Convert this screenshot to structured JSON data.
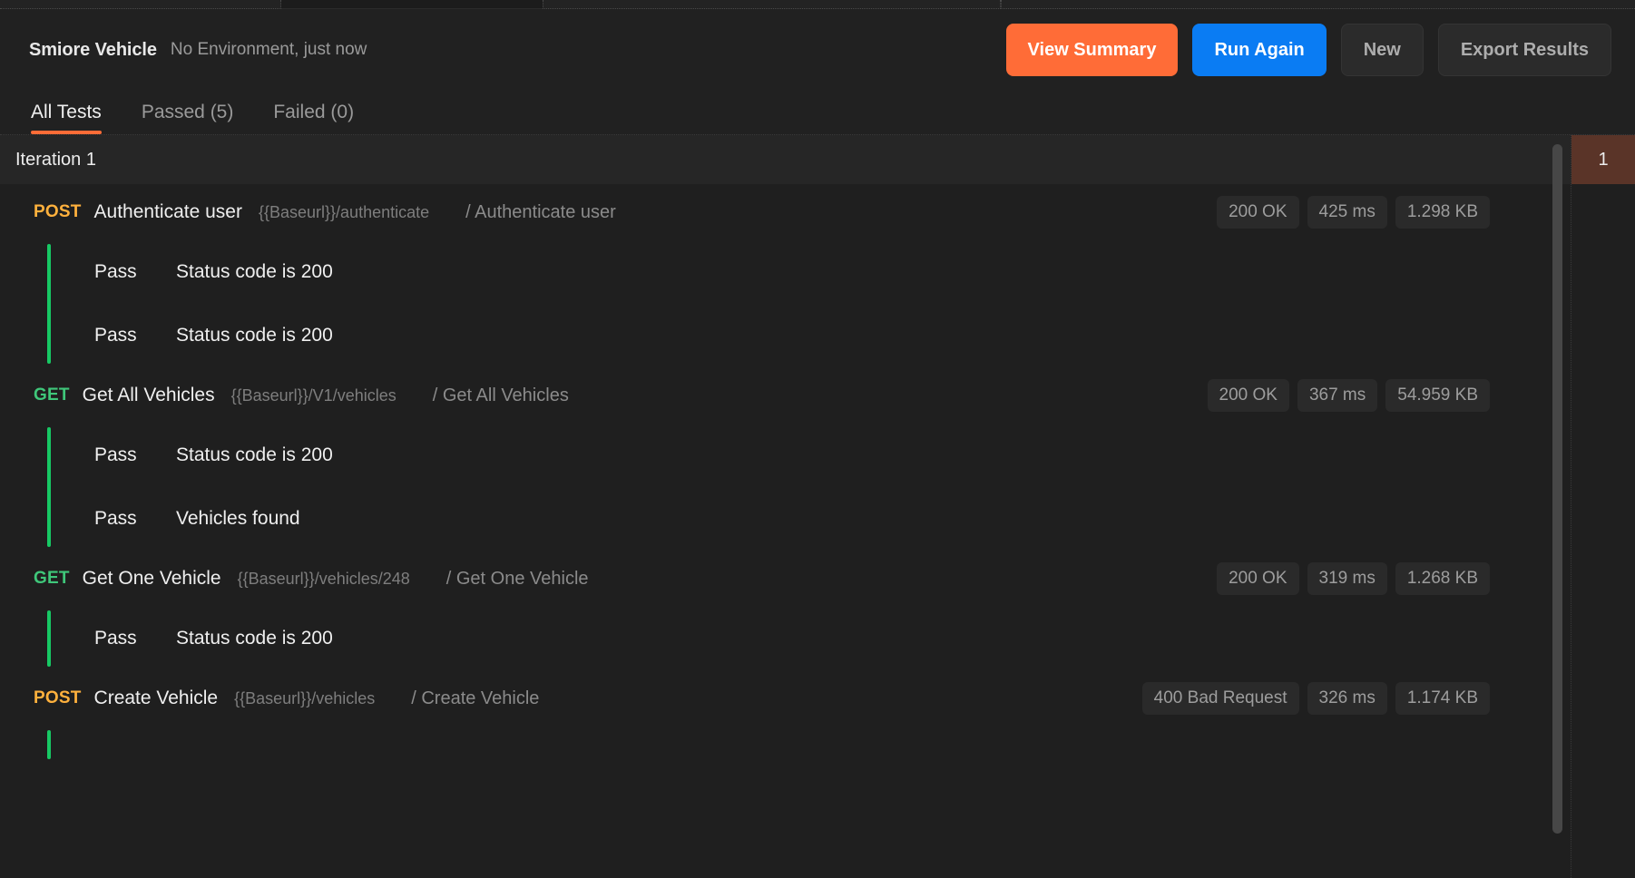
{
  "header": {
    "run_title": "Smiore Vehicle",
    "run_meta": "No Environment, just now",
    "actions": {
      "view_summary": "View Summary",
      "run_again": "Run Again",
      "new": "New",
      "export_results": "Export Results"
    }
  },
  "tabs": [
    {
      "label": "All Tests",
      "active": true
    },
    {
      "label": "Passed (5)",
      "active": false
    },
    {
      "label": "Failed (0)",
      "active": false
    }
  ],
  "iteration": {
    "label": "Iteration 1"
  },
  "requests": [
    {
      "method": "POST",
      "name": "Authenticate user",
      "url": "{{Baseurl}}/authenticate",
      "path": "/ Authenticate user",
      "status": "200 OK",
      "time": "425 ms",
      "size": "1.298 KB",
      "assertions": [
        {
          "result": "Pass",
          "text": "Status code is 200"
        },
        {
          "result": "Pass",
          "text": "Status code is 200"
        }
      ]
    },
    {
      "method": "GET",
      "name": "Get All Vehicles",
      "url": "{{Baseurl}}/V1/vehicles",
      "path": "/ Get All Vehicles",
      "status": "200 OK",
      "time": "367 ms",
      "size": "54.959 KB",
      "assertions": [
        {
          "result": "Pass",
          "text": "Status code is 200"
        },
        {
          "result": "Pass",
          "text": "Vehicles found"
        }
      ]
    },
    {
      "method": "GET",
      "name": "Get One Vehicle",
      "url": "{{Baseurl}}/vehicles/248",
      "path": "/ Get One Vehicle",
      "status": "200 OK",
      "time": "319 ms",
      "size": "1.268 KB",
      "assertions": [
        {
          "result": "Pass",
          "text": "Status code is 200"
        }
      ]
    },
    {
      "method": "POST",
      "name": "Create Vehicle",
      "url": "{{Baseurl}}/vehicles",
      "path": "/ Create Vehicle",
      "status": "400 Bad Request",
      "time": "326 ms",
      "size": "1.174 KB",
      "assertions": []
    }
  ],
  "sidebar": {
    "items": [
      {
        "label": "1",
        "active": true
      }
    ]
  },
  "colors": {
    "accent_orange": "#ff6c37",
    "accent_blue": "#0a7cf3",
    "pass_green": "#17c964",
    "method_post": "#ffb13d",
    "method_get": "#3fc77a",
    "side_active": "#5a3428"
  }
}
